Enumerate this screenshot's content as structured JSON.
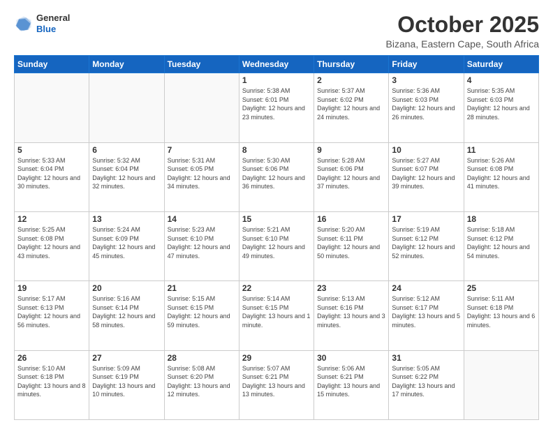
{
  "header": {
    "logo_line1": "General",
    "logo_line2": "Blue",
    "month": "October 2025",
    "location": "Bizana, Eastern Cape, South Africa"
  },
  "weekdays": [
    "Sunday",
    "Monday",
    "Tuesday",
    "Wednesday",
    "Thursday",
    "Friday",
    "Saturday"
  ],
  "weeks": [
    [
      {
        "day": "",
        "info": ""
      },
      {
        "day": "",
        "info": ""
      },
      {
        "day": "",
        "info": ""
      },
      {
        "day": "1",
        "info": "Sunrise: 5:38 AM\nSunset: 6:01 PM\nDaylight: 12 hours\nand 23 minutes."
      },
      {
        "day": "2",
        "info": "Sunrise: 5:37 AM\nSunset: 6:02 PM\nDaylight: 12 hours\nand 24 minutes."
      },
      {
        "day": "3",
        "info": "Sunrise: 5:36 AM\nSunset: 6:03 PM\nDaylight: 12 hours\nand 26 minutes."
      },
      {
        "day": "4",
        "info": "Sunrise: 5:35 AM\nSunset: 6:03 PM\nDaylight: 12 hours\nand 28 minutes."
      }
    ],
    [
      {
        "day": "5",
        "info": "Sunrise: 5:33 AM\nSunset: 6:04 PM\nDaylight: 12 hours\nand 30 minutes."
      },
      {
        "day": "6",
        "info": "Sunrise: 5:32 AM\nSunset: 6:04 PM\nDaylight: 12 hours\nand 32 minutes."
      },
      {
        "day": "7",
        "info": "Sunrise: 5:31 AM\nSunset: 6:05 PM\nDaylight: 12 hours\nand 34 minutes."
      },
      {
        "day": "8",
        "info": "Sunrise: 5:30 AM\nSunset: 6:06 PM\nDaylight: 12 hours\nand 36 minutes."
      },
      {
        "day": "9",
        "info": "Sunrise: 5:28 AM\nSunset: 6:06 PM\nDaylight: 12 hours\nand 37 minutes."
      },
      {
        "day": "10",
        "info": "Sunrise: 5:27 AM\nSunset: 6:07 PM\nDaylight: 12 hours\nand 39 minutes."
      },
      {
        "day": "11",
        "info": "Sunrise: 5:26 AM\nSunset: 6:08 PM\nDaylight: 12 hours\nand 41 minutes."
      }
    ],
    [
      {
        "day": "12",
        "info": "Sunrise: 5:25 AM\nSunset: 6:08 PM\nDaylight: 12 hours\nand 43 minutes."
      },
      {
        "day": "13",
        "info": "Sunrise: 5:24 AM\nSunset: 6:09 PM\nDaylight: 12 hours\nand 45 minutes."
      },
      {
        "day": "14",
        "info": "Sunrise: 5:23 AM\nSunset: 6:10 PM\nDaylight: 12 hours\nand 47 minutes."
      },
      {
        "day": "15",
        "info": "Sunrise: 5:21 AM\nSunset: 6:10 PM\nDaylight: 12 hours\nand 49 minutes."
      },
      {
        "day": "16",
        "info": "Sunrise: 5:20 AM\nSunset: 6:11 PM\nDaylight: 12 hours\nand 50 minutes."
      },
      {
        "day": "17",
        "info": "Sunrise: 5:19 AM\nSunset: 6:12 PM\nDaylight: 12 hours\nand 52 minutes."
      },
      {
        "day": "18",
        "info": "Sunrise: 5:18 AM\nSunset: 6:12 PM\nDaylight: 12 hours\nand 54 minutes."
      }
    ],
    [
      {
        "day": "19",
        "info": "Sunrise: 5:17 AM\nSunset: 6:13 PM\nDaylight: 12 hours\nand 56 minutes."
      },
      {
        "day": "20",
        "info": "Sunrise: 5:16 AM\nSunset: 6:14 PM\nDaylight: 12 hours\nand 58 minutes."
      },
      {
        "day": "21",
        "info": "Sunrise: 5:15 AM\nSunset: 6:15 PM\nDaylight: 12 hours\nand 59 minutes."
      },
      {
        "day": "22",
        "info": "Sunrise: 5:14 AM\nSunset: 6:15 PM\nDaylight: 13 hours\nand 1 minute."
      },
      {
        "day": "23",
        "info": "Sunrise: 5:13 AM\nSunset: 6:16 PM\nDaylight: 13 hours\nand 3 minutes."
      },
      {
        "day": "24",
        "info": "Sunrise: 5:12 AM\nSunset: 6:17 PM\nDaylight: 13 hours\nand 5 minutes."
      },
      {
        "day": "25",
        "info": "Sunrise: 5:11 AM\nSunset: 6:18 PM\nDaylight: 13 hours\nand 6 minutes."
      }
    ],
    [
      {
        "day": "26",
        "info": "Sunrise: 5:10 AM\nSunset: 6:18 PM\nDaylight: 13 hours\nand 8 minutes."
      },
      {
        "day": "27",
        "info": "Sunrise: 5:09 AM\nSunset: 6:19 PM\nDaylight: 13 hours\nand 10 minutes."
      },
      {
        "day": "28",
        "info": "Sunrise: 5:08 AM\nSunset: 6:20 PM\nDaylight: 13 hours\nand 12 minutes."
      },
      {
        "day": "29",
        "info": "Sunrise: 5:07 AM\nSunset: 6:21 PM\nDaylight: 13 hours\nand 13 minutes."
      },
      {
        "day": "30",
        "info": "Sunrise: 5:06 AM\nSunset: 6:21 PM\nDaylight: 13 hours\nand 15 minutes."
      },
      {
        "day": "31",
        "info": "Sunrise: 5:05 AM\nSunset: 6:22 PM\nDaylight: 13 hours\nand 17 minutes."
      },
      {
        "day": "",
        "info": ""
      }
    ]
  ]
}
